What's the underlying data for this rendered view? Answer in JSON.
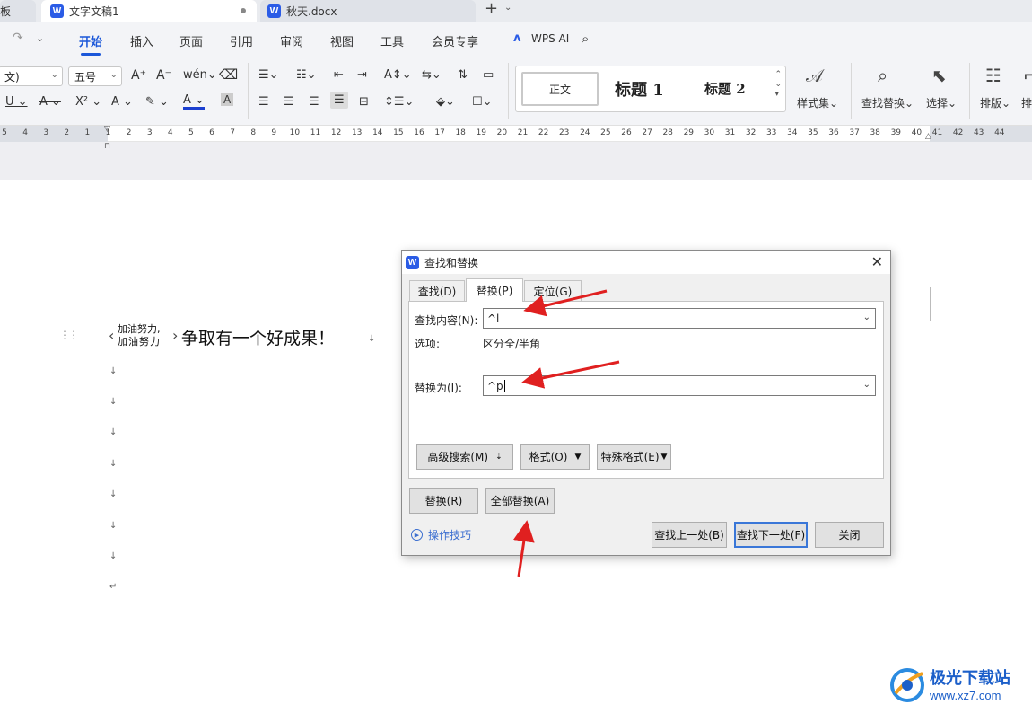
{
  "tabs": [
    {
      "label": "板"
    },
    {
      "label": "文字文稿1"
    },
    {
      "label": "秋天.docx"
    }
  ],
  "menu": [
    "开始",
    "插入",
    "页面",
    "引用",
    "审阅",
    "视图",
    "工具",
    "会员专享"
  ],
  "wps_ai": "WPS AI",
  "ribbon": {
    "font_name": "文)",
    "font_size": "五号",
    "style_normal": "正文",
    "style_h1": "标题 1",
    "style_h2": "标题 2",
    "style_set": "样式集",
    "find_replace": "查找替换",
    "select": "选择",
    "layout": "排版",
    "cut_label": "排"
  },
  "ruler_ticks": [
    "5",
    "4",
    "3",
    "2",
    "1",
    "1",
    "2",
    "3",
    "4",
    "5",
    "6",
    "7",
    "8",
    "9",
    "10",
    "11",
    "12",
    "13",
    "14",
    "15",
    "16",
    "17",
    "18",
    "19",
    "20",
    "21",
    "22",
    "23",
    "24",
    "25",
    "26",
    "27",
    "28",
    "29",
    "30",
    "31",
    "32",
    "33",
    "34",
    "35",
    "36",
    "37",
    "38",
    "39",
    "40",
    "41",
    "42",
    "43",
    "44"
  ],
  "document": {
    "combined_top": "加油努力,",
    "combined_bottom": "加油努力",
    "line_text": "争取有一个好成果！"
  },
  "dialog": {
    "title": "查找和替换",
    "tabs": [
      "查找(D)",
      "替换(P)",
      "定位(G)"
    ],
    "find_label": "查找内容(N):",
    "find_value": "^l",
    "options_label": "选项:",
    "options_value": "区分全/半角",
    "replace_label": "替换为(I):",
    "replace_value": "^p",
    "btn_advanced": "高级搜索(M)",
    "btn_format": "格式(O)",
    "btn_special": "特殊格式(E)",
    "btn_replace": "替换(R)",
    "btn_replace_all": "全部替换(A)",
    "tips": "操作技巧",
    "btn_find_prev": "查找上一处(B)",
    "btn_find_next": "查找下一处(F)",
    "btn_close": "关闭"
  },
  "watermark": {
    "name": "极光下载站",
    "url": "www.xz7.com"
  },
  "colors": {
    "accent": "#1b57d9",
    "arrow": "#e02020",
    "dialog_bg": "#f0f0f0"
  }
}
